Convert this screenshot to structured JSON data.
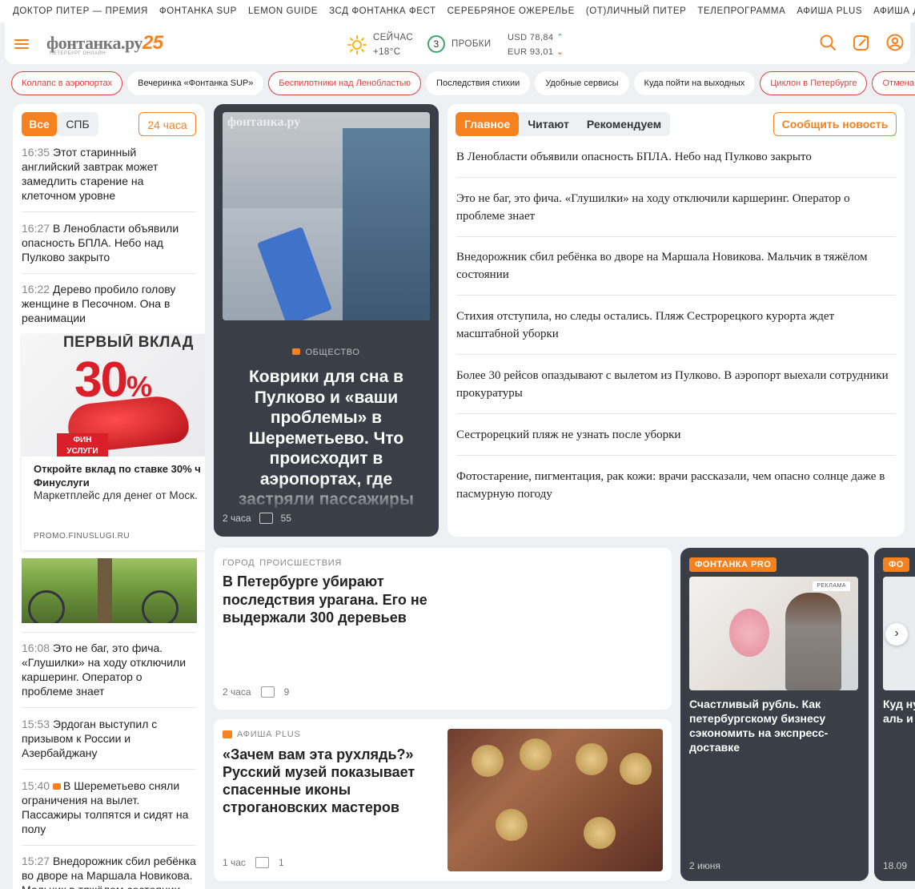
{
  "top_projects": [
    "Доктор Питер — премия",
    "Фонтанка SUP",
    "Lemon Guide",
    "ЗСД Фонтанка Фест",
    "Серебряное ожерелье",
    "(От)личный Питер",
    "Телепрограмма",
    "Афиша Plus",
    "Афиша для дет"
  ],
  "header": {
    "logo_text": "фонтанка.ру",
    "logo_anniversary": "25",
    "logo_sub": "ПЕТЕРБУРГ ОНЛАЙН",
    "weather_label": "СЕЙЧАС",
    "weather_temp": "+18°C",
    "traffic_score": "3",
    "traffic_label": "ПРОБКИ",
    "usd": "USD 78,84",
    "eur": "EUR 93,01",
    "colors": {
      "accent": "#f5821f",
      "up": "#3aa66b",
      "down": "#e2413c"
    }
  },
  "tags": [
    {
      "label": "Коллапс в аэропортах",
      "highlight": true
    },
    {
      "label": "Вечеринка «Фонтанка SUP»",
      "highlight": false
    },
    {
      "label": "Беспилотники над Ленобластью",
      "highlight": true
    },
    {
      "label": "Последствия стихии",
      "highlight": false
    },
    {
      "label": "Удобные сервисы",
      "highlight": false
    },
    {
      "label": "Куда пойти на выходных",
      "highlight": false
    },
    {
      "label": "Циклон в Петербурге",
      "highlight": true
    },
    {
      "label": "Отмена Гл",
      "highlight": true
    }
  ],
  "feed": {
    "filters": {
      "all": "Все",
      "spb": "СПБ",
      "day": "24 часа"
    },
    "items_top": [
      {
        "time": "16:35",
        "text": "Этот старинный английский завтрак может замедлить старение на клеточном уровне"
      },
      {
        "time": "16:27",
        "text": "В Ленобласти объявили опасность БПЛА. Небо над Пулково закрыто"
      },
      {
        "time": "16:22",
        "text": "Дерево пробило голову женщине в Песочном. Она в реанимации"
      }
    ],
    "ad": {
      "headline": "ПЕРВЫЙ ВКЛАД",
      "percent": "30",
      "percent_sign": "%",
      "badge": "ФИН УСЛУГИ",
      "title": "Откройте вклад по ставке 30% ч Финуслуги",
      "text": "Маркетплейс для денег от Моск.",
      "source": "PROMO.FINUSLUGI.RU"
    },
    "items_bottom": [
      {
        "time": "16:08",
        "text": "Это не баг, это фича. «Глушилки» на ходу отключили каршеринг. Оператор о проблеме знает",
        "video": false
      },
      {
        "time": "15:53",
        "text": "Эрдоган выступил с призывом к России и Азербайджану",
        "video": false
      },
      {
        "time": "15:40",
        "text": "В Шереметьево сняли ограничения на вылет. Пассажиры толпятся и сидят на полу",
        "video": true
      },
      {
        "time": "15:27",
        "text": "Внедорожник сбил ребёнка во дворе на Маршала Новикова. Мальчик в тяжёлом состоянии",
        "video": false
      }
    ]
  },
  "feature": {
    "watermark": "фонтанка.ру",
    "category": "ОБЩЕСТВО",
    "title": "Коврики для сна в Пулково и «ваши проблемы» в Шереметьево. Что происходит в аэропортах, где застряли пассажиры",
    "time": "2 часа",
    "comments": "55"
  },
  "main": {
    "tabs": [
      "Главное",
      "Читают",
      "Рекомендуем"
    ],
    "report_button": "Сообщить новость",
    "items": [
      "В Ленобласти объявили опасность БПЛА. Небо над Пулково закрыто",
      "Это не баг, это фича. «Глушилки» на ходу отключили каршеринг. Оператор о проблеме знает",
      "Внедорожник сбил ребёнка во дворе на Маршала Новикова. Мальчик в тяжёлом состоянии",
      "Стихия отступила, но следы остались. Пляж Сестрорецкого курорта ждет масштабной уборки",
      "Более 30 рейсов опаздывают с вылетом из Пулково. В аэропорт выехали сотрудники прокуратуры",
      "Сестрорецкий пляж не узнать после уборки",
      "Фотостарение, пигментация, рак кожи: врачи рассказали, чем опасно солнце даже в пасмурную погоду"
    ]
  },
  "card_city": {
    "rubric1": "ГОРОД",
    "rubric2": "ПРОИСШЕСТВИЯ",
    "title": "В Петербурге убирают последствия урагана. Его не выдержали 300 деревьев",
    "time": "2 часа",
    "comments": "9"
  },
  "card_afisha": {
    "category": "АФИША PLUS",
    "title": "«Зачем вам эта рухлядь?» Русский музей показывает спасенные иконы строгановских мастеров",
    "time": "1 час",
    "comments": "1"
  },
  "pro_cards": [
    {
      "badge": "ФОНТАНКА PRO",
      "ad_label": "РЕКЛАМА",
      "title": "Счастливый рубль. Как петербургскому бизнесу сэкономить на экспресс-доставке",
      "date": "2 июня"
    },
    {
      "badge": "ФО",
      "title": "Куд нуж аль и кр",
      "date": "18.09"
    }
  ]
}
